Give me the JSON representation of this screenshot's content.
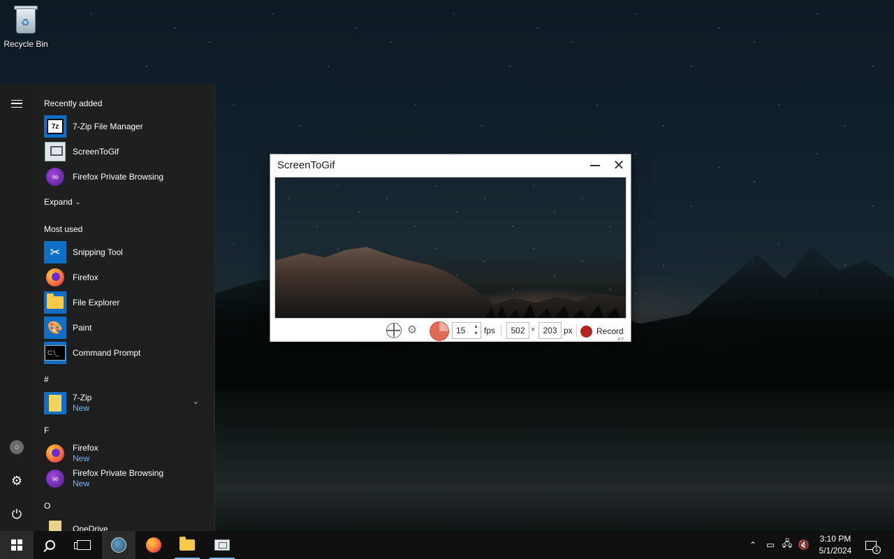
{
  "desktop": {
    "icons": [
      {
        "label": "Recycle Bin",
        "icon": "recycle-bin-icon"
      }
    ]
  },
  "start_menu": {
    "rail": {
      "menu_icon": "hamburger-menu-icon",
      "account_icon": "user-account-icon",
      "settings_icon": "gear-icon",
      "power_icon": "power-icon"
    },
    "recently_added": {
      "header": "Recently added",
      "items": [
        {
          "name": "7-Zip File Manager",
          "icon": "7zip-icon"
        },
        {
          "name": "ScreenToGif",
          "icon": "screentogif-icon"
        },
        {
          "name": "Firefox Private Browsing",
          "icon": "firefox-private-icon"
        }
      ],
      "expand_label": "Expand"
    },
    "most_used": {
      "header": "Most used",
      "items": [
        {
          "name": "Snipping Tool",
          "icon": "snipping-tool-icon"
        },
        {
          "name": "Firefox",
          "icon": "firefox-icon"
        },
        {
          "name": "File Explorer",
          "icon": "file-explorer-icon"
        },
        {
          "name": "Paint",
          "icon": "paint-icon"
        },
        {
          "name": "Command Prompt",
          "icon": "command-prompt-icon"
        }
      ]
    },
    "groups": [
      {
        "letter": "#",
        "items": [
          {
            "name": "7-Zip",
            "sub": "New",
            "icon": "folder-icon",
            "expandable": true
          }
        ]
      },
      {
        "letter": "F",
        "items": [
          {
            "name": "Firefox",
            "sub": "New",
            "icon": "firefox-icon"
          },
          {
            "name": "Firefox Private Browsing",
            "sub": "New",
            "icon": "firefox-private-icon"
          }
        ]
      },
      {
        "letter": "O",
        "items": [
          {
            "name": "OneDrive",
            "icon": "onedrive-icon"
          }
        ]
      }
    ]
  },
  "screentogif": {
    "title": "ScreenToGif",
    "toolbar": {
      "fps_value": "15",
      "fps_label": "fps",
      "width_value": "502",
      "x_label": "×",
      "height_value": "203",
      "px_label": "px",
      "record_label": "Record",
      "record_shortcut": "F7"
    }
  },
  "taskbar": {
    "clock_time": "3:10 PM",
    "clock_date": "5/1/2024",
    "notification_count": "1"
  }
}
